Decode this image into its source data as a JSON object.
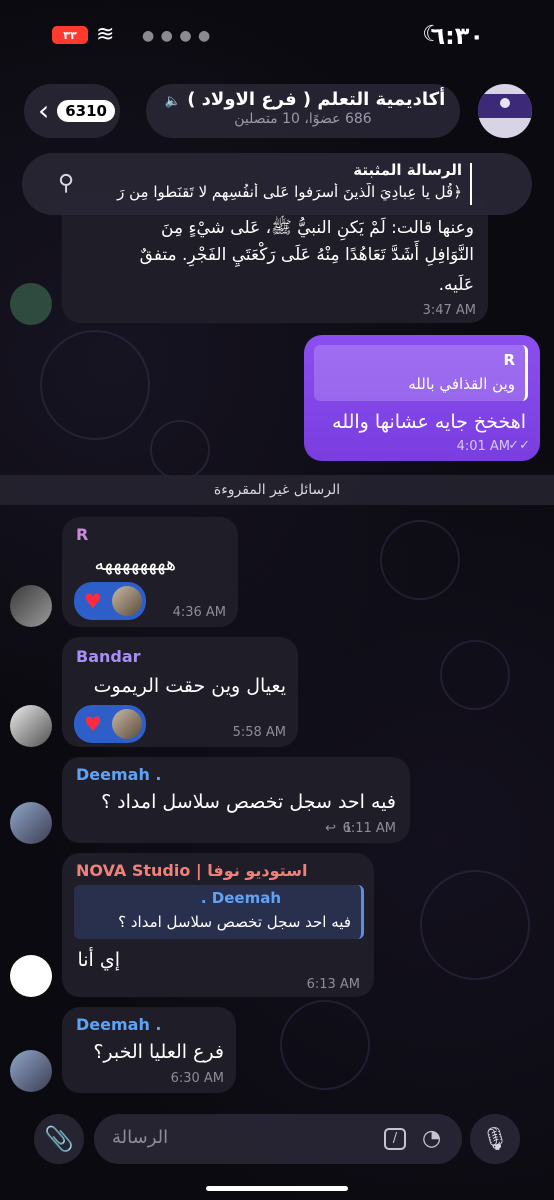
{
  "status_bar": {
    "time": "٦:٣٠",
    "battery": "٣٣"
  },
  "header": {
    "back_count": "6310",
    "title": "أكاديمية التعلم ( فرع الاولاد )",
    "subtitle": "686 عضوًا، 10 متصلين"
  },
  "pinned": {
    "label": "الرسالة المثبتة",
    "text": "﴿قُل يا عِبادِيَ الَّذينَ أَسرَفوا عَلى أَنفُسِهِم لا تَقنَطوا مِن رَ"
  },
  "messages": [
    {
      "line1": "وعنها قالت: لَمْ يَكنِ النبيُّ ﷺ، عَلى شيْءٍ مِنَ",
      "line2": "النَّوَافِلِ أَشَدَّ تَعَاهُدًا مِنْهُ عَلَى رَكْعَتَيِ الفَجْرِ. متفقٌ",
      "line3": "عَلَيه.",
      "time": "3:47 AM"
    },
    {
      "quote_name": "R",
      "quote_text": "وين القذافي بالله",
      "text": "اهخخخ جايه عشانها والله",
      "time": "4:01 AM"
    },
    {
      "name": "R",
      "text": "ههههههههه",
      "time": "4:36 AM"
    },
    {
      "name": "Bandar",
      "text": "يعيال وين حقت الريموت",
      "time": "5:58 AM"
    },
    {
      "name": "Deemah .",
      "text": "فيه احد سجل تخصص سلاسل امداد ؟",
      "replies": "1",
      "time": "6:11 AM"
    },
    {
      "name": "NOVA Studio | استوديو نوفا",
      "quote_name": "Deemah .",
      "quote_text": "فيه احد سجل تخصص سلاسل امداد ؟",
      "text": "إي أنا",
      "time": "6:13 AM"
    },
    {
      "name": "Deemah .",
      "text": "فرع العليا الخبر؟",
      "time": "6:30 AM"
    }
  ],
  "unread_label": "الرسائل غير المقروءة",
  "composer": {
    "placeholder": "الرسالة"
  },
  "colors": {
    "outgoing": "#8b4ff0",
    "name_r": "#c98ad8",
    "name_bandar": "#a98ef5",
    "name_deemah": "#5fa3f5",
    "name_nova": "#f0807a",
    "reaction_bg": "#2e5fc9"
  }
}
